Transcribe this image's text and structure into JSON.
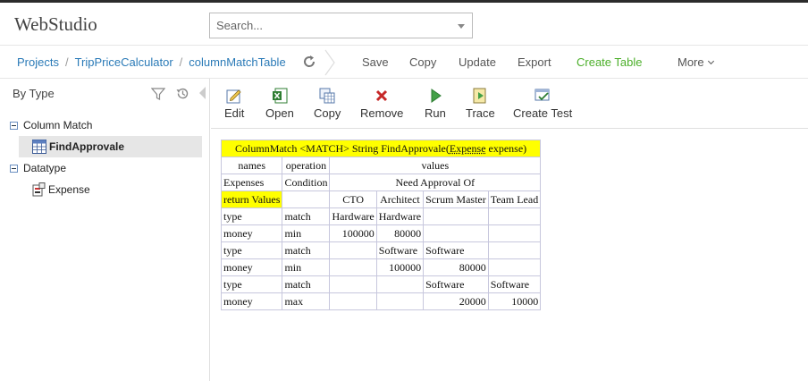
{
  "app": {
    "title": "WebStudio"
  },
  "search": {
    "placeholder": "Search..."
  },
  "breadcrumb": {
    "projects": "Projects",
    "project": "TripPriceCalculator",
    "module": "columnMatchTable"
  },
  "nav_actions": {
    "save": "Save",
    "copy": "Copy",
    "update": "Update",
    "export": "Export",
    "create_table": "Create Table",
    "more": "More"
  },
  "left_panel": {
    "view_label": "By Type",
    "tree": {
      "group1": "Column Match",
      "group1_item": "FindApprovale",
      "group2": "Datatype",
      "group2_item": "Expense"
    }
  },
  "toolbar": {
    "edit": "Edit",
    "open": "Open",
    "copy": "Copy",
    "remove": "Remove",
    "run": "Run",
    "trace": "Trace",
    "create_test": "Create Test"
  },
  "table": {
    "header_pre": "ColumnMatch <MATCH> String FindApprovale(",
    "header_link": "Expense",
    "header_post": " expense)",
    "col_names": "names",
    "col_operation": "operation",
    "col_values": "values",
    "row_expenses": "Expenses",
    "row_condition": "Condition",
    "need_approval": "Need Approval Of",
    "return_values": "return Values",
    "roles": [
      "CTO",
      "Architect",
      "Scrum Master",
      "Team Lead"
    ],
    "rows": [
      [
        "type",
        "match",
        "Hardware",
        "Hardware",
        "",
        ""
      ],
      [
        "money",
        "min",
        "100000",
        "80000",
        "",
        ""
      ],
      [
        "type",
        "match",
        "",
        "Software",
        "Software",
        ""
      ],
      [
        "money",
        "min",
        "",
        "100000",
        "80000",
        ""
      ],
      [
        "type",
        "match",
        "",
        "",
        "Software",
        "Software"
      ],
      [
        "money",
        "max",
        "",
        "",
        "20000",
        "10000"
      ]
    ]
  },
  "colors": {
    "link": "#2a7ab7",
    "create_table": "#4caf2a",
    "highlight": "#ffff00",
    "grid": "#c7c7dd"
  }
}
